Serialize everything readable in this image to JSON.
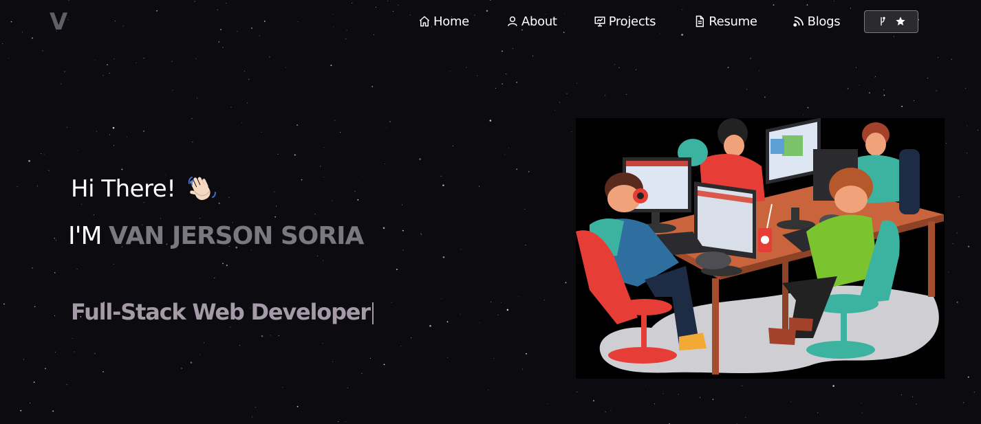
{
  "logo": {
    "text": "V"
  },
  "nav": {
    "items": [
      {
        "label": "Home",
        "icon": "home-icon"
      },
      {
        "label": "About",
        "icon": "user-icon"
      },
      {
        "label": "Projects",
        "icon": "presentation-icon"
      },
      {
        "label": "Resume",
        "icon": "document-icon"
      },
      {
        "label": "Blogs",
        "icon": "rss-icon"
      }
    ],
    "github_button": {
      "icons": [
        "git-fork-icon",
        "star-icon"
      ]
    }
  },
  "hero": {
    "greeting": "Hi There!",
    "greeting_emoji": "waving-hand-icon",
    "name_prefix": "I'M ",
    "name": "VAN JERSON SORIA",
    "role": "Full-Stack Web Developer"
  },
  "colors": {
    "background": "#0c0b0f",
    "name_accent": "#7c7880",
    "role_accent": "#a49aa8"
  }
}
